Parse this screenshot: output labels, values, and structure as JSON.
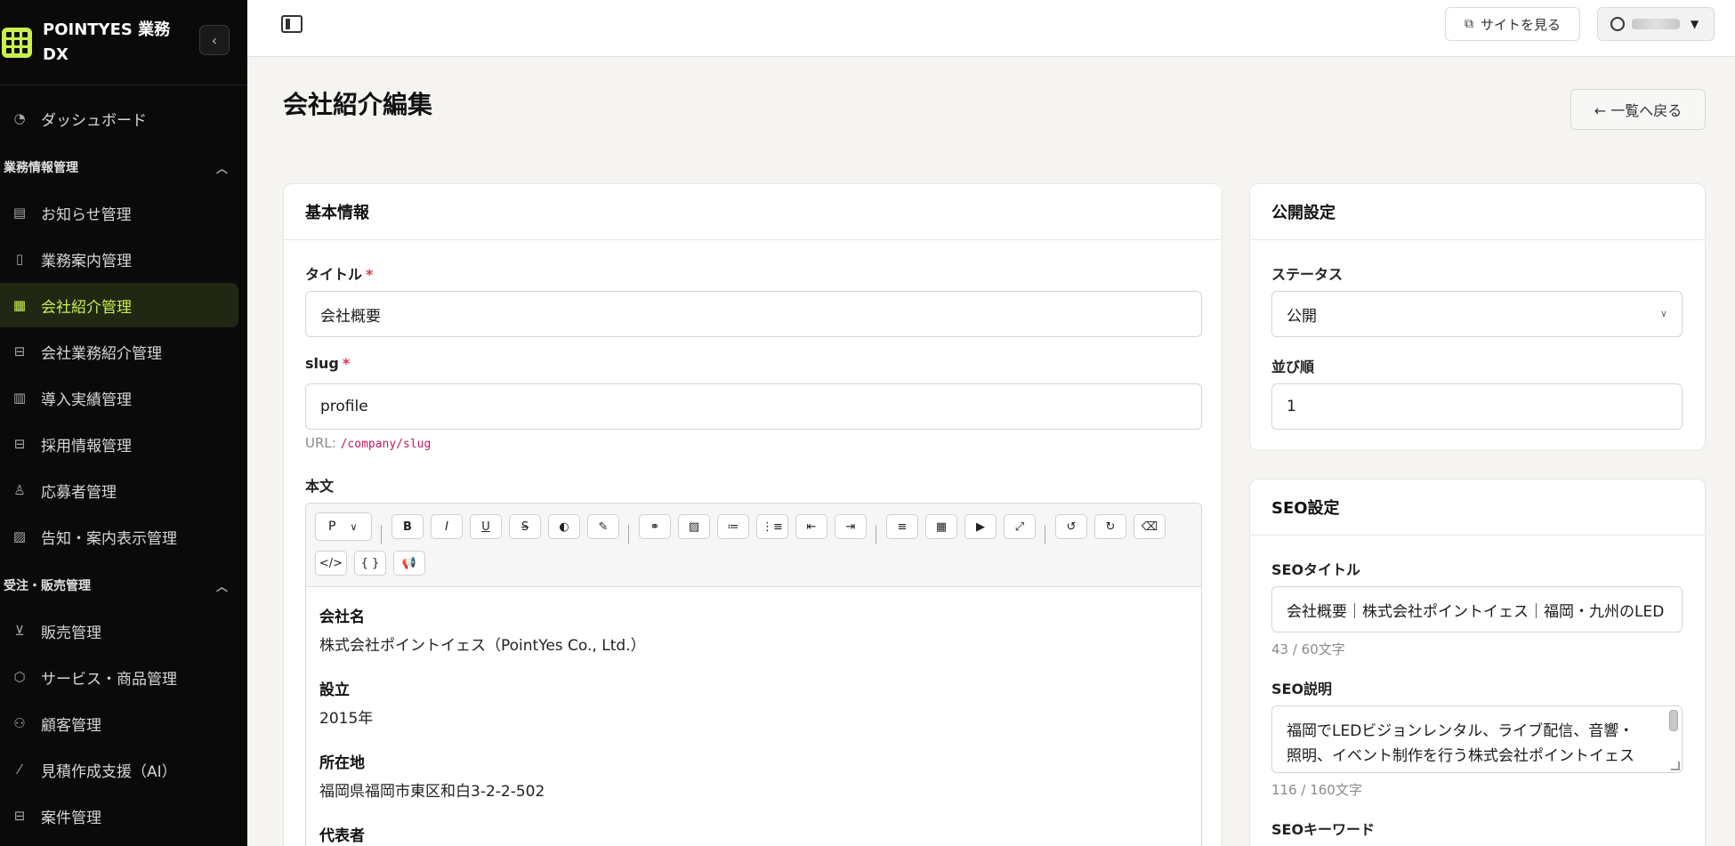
{
  "brand": {
    "name": "POINTYES 業務 DX"
  },
  "sidebar": {
    "top_items": [
      {
        "label": "ダッシュボード",
        "icon": "gauge-icon"
      }
    ],
    "sections": [
      {
        "title": "業務情報管理",
        "items": [
          {
            "label": "お知らせ管理",
            "icon": "newspaper-icon"
          },
          {
            "label": "業務案内管理",
            "icon": "document-icon"
          },
          {
            "label": "会社紹介管理",
            "icon": "building-icon",
            "active": true
          },
          {
            "label": "会社業務紹介管理",
            "icon": "briefcase-icon"
          },
          {
            "label": "導入実績管理",
            "icon": "film-icon"
          },
          {
            "label": "採用情報管理",
            "icon": "briefcase-icon"
          },
          {
            "label": "応募者管理",
            "icon": "user-check-icon"
          },
          {
            "label": "告知・案内表示管理",
            "icon": "image-icon"
          }
        ]
      },
      {
        "title": "受注・販売管理",
        "items": [
          {
            "label": "販売管理",
            "icon": "cart-icon"
          },
          {
            "label": "サービス・商品管理",
            "icon": "box-icon"
          },
          {
            "label": "顧客管理",
            "icon": "users-icon"
          },
          {
            "label": "見積作成支援（AI）",
            "icon": "magic-wand-icon"
          },
          {
            "label": "案件管理",
            "icon": "briefcase-icon"
          }
        ]
      }
    ]
  },
  "topbar": {
    "view_site": "サイトを見る"
  },
  "page": {
    "title": "会社紹介編集",
    "back": "← 一覧へ戻る"
  },
  "basic": {
    "heading": "基本情報",
    "title_label": "タイトル",
    "title_value": "会社概要",
    "slug_label": "slug",
    "slug_value": "profile",
    "url_prefix": "URL:",
    "url_path": "/company/slug",
    "body_label": "本文",
    "paragraph_style": "P",
    "body": [
      {
        "label": "会社名",
        "value": "株式会社ポイントイェス（PointYes Co., Ltd.）"
      },
      {
        "label": "設立",
        "value": "2015年"
      },
      {
        "label": "所在地",
        "value": "福岡県福岡市東区和白3-2-2-502"
      },
      {
        "label": "代表者",
        "value": ""
      }
    ]
  },
  "publish": {
    "heading": "公開設定",
    "status_label": "ステータス",
    "status_value": "公開",
    "order_label": "並び順",
    "order_value": "1"
  },
  "seo": {
    "heading": "SEO設定",
    "title_label": "SEOタイトル",
    "title_value": "会社概要｜株式会社ポイントイェス｜福岡・九州のLED",
    "title_count": "43 / 60文字",
    "desc_label": "SEO説明",
    "desc_value": "福岡でLEDビジョンレンタル、ライブ配信、音響・照明、イベント制作を行う株式会社ポイントイェスの会社概要。九州全域・全国対応。展示会・企業イ",
    "desc_count": "116 / 160文字",
    "keywords_label": "SEOキーワード"
  },
  "colors": {
    "accent": "#c9ef50",
    "sidebar_bg": "#0a0a0a",
    "required": "#d9374a"
  }
}
